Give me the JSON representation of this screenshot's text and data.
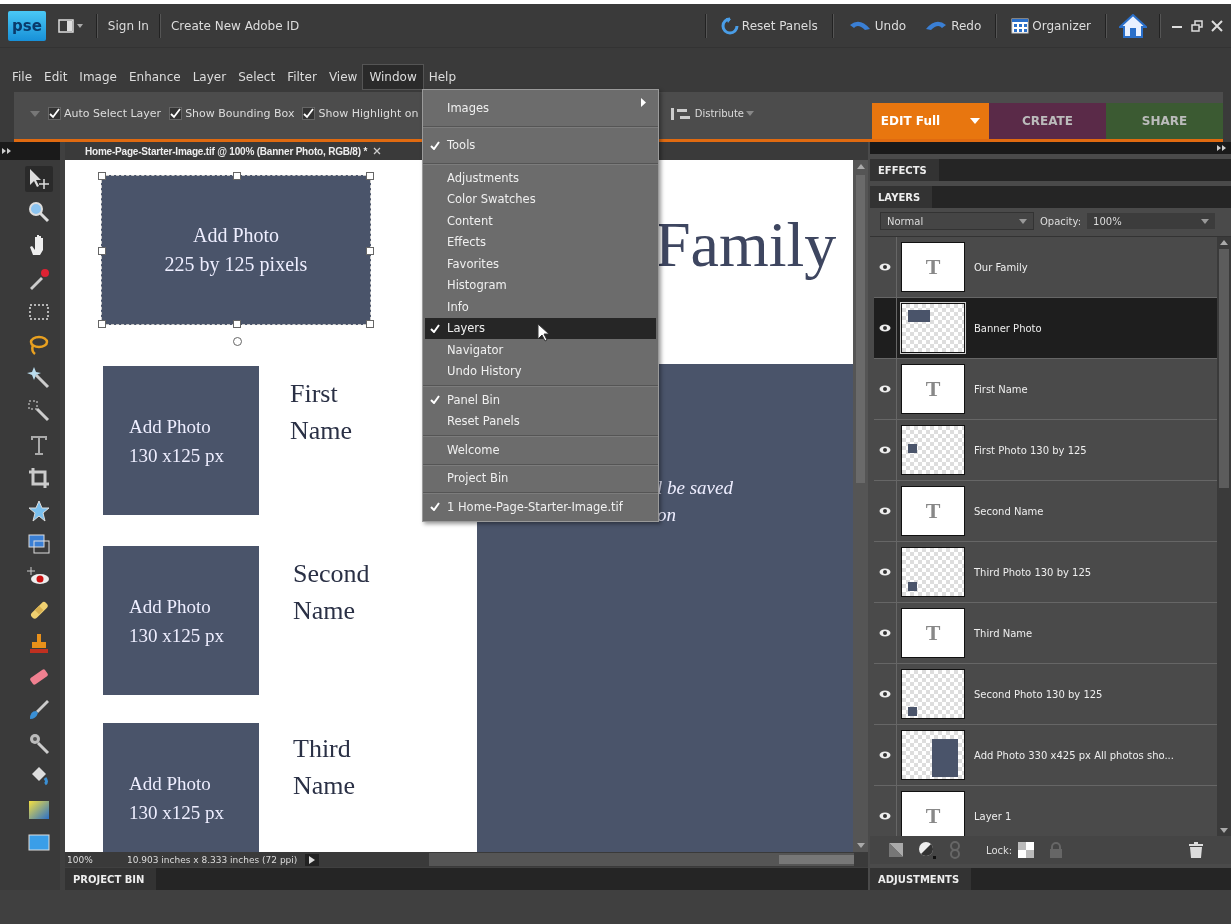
{
  "title_bar": {
    "logo": "pse",
    "sign_in": "Sign In",
    "create_id": "Create New Adobe ID",
    "actions": [
      {
        "kind": "reset",
        "label": "Reset Panels"
      },
      {
        "kind": "undo",
        "label": "Undo"
      },
      {
        "kind": "redo",
        "label": "Redo"
      },
      {
        "kind": "organizer",
        "label": "Organizer"
      }
    ]
  },
  "menu_bar": [
    {
      "label": "File",
      "selected": false
    },
    {
      "label": "Edit",
      "selected": false
    },
    {
      "label": "Image",
      "selected": false
    },
    {
      "label": "Enhance",
      "selected": false
    },
    {
      "label": "Layer",
      "selected": false
    },
    {
      "label": "Select",
      "selected": false
    },
    {
      "label": "Filter",
      "selected": false
    },
    {
      "label": "View",
      "selected": false
    },
    {
      "label": "Window",
      "selected": true
    },
    {
      "label": "Help",
      "selected": false
    }
  ],
  "options_bar": {
    "checkboxes": [
      {
        "label": "Auto Select Layer",
        "checked": true
      },
      {
        "label": "Show Bounding Box",
        "checked": true
      },
      {
        "label": "Show Highlight on",
        "checked": true
      }
    ],
    "distribute": "Distribute"
  },
  "mode_tabs": [
    {
      "label": "EDIT Full",
      "selected": true,
      "color": "#e8760f"
    },
    {
      "label": "CREATE",
      "selected": false,
      "color": "#5a2a48"
    },
    {
      "label": "SHARE",
      "selected": false,
      "color": "#3b5a32"
    }
  ],
  "document_tab": {
    "title": "Home-Page-Starter-Image.tif @ 100% (Banner Photo, RGB/8) *"
  },
  "tools": [
    {
      "kind": "move",
      "selected": true
    },
    {
      "kind": "zoom",
      "selected": false
    },
    {
      "kind": "hand",
      "selected": false
    },
    {
      "kind": "eyedropper",
      "selected": false
    },
    {
      "kind": "marquee",
      "selected": false
    },
    {
      "kind": "lasso",
      "selected": false
    },
    {
      "kind": "wand",
      "selected": false
    },
    {
      "kind": "brushsel",
      "selected": false
    },
    {
      "kind": "type",
      "selected": false
    },
    {
      "kind": "crop",
      "selected": false
    },
    {
      "kind": "shape",
      "selected": false
    },
    {
      "kind": "recompose",
      "selected": false
    },
    {
      "kind": "redeye",
      "selected": false
    },
    {
      "kind": "heal",
      "selected": false
    },
    {
      "kind": "stamp",
      "selected": false
    },
    {
      "kind": "eraser",
      "selected": false
    },
    {
      "kind": "brush",
      "selected": false
    },
    {
      "kind": "smartbrush",
      "selected": false
    },
    {
      "kind": "bucket",
      "selected": false
    },
    {
      "kind": "gradient",
      "selected": false
    },
    {
      "kind": "rect",
      "selected": false
    }
  ],
  "canvas": {
    "banner": {
      "line1": "Add Photo",
      "line2": "225 by 125 pixels"
    },
    "photos": [
      {
        "line1": "Add Photo",
        "line2": "130 x125 px",
        "name1": "First",
        "name2": "Name"
      },
      {
        "line1": "Add Photo",
        "line2": "130 x125 px",
        "name1": "Second",
        "name2": "Name"
      },
      {
        "line1": "Add Photo",
        "line2": "130 x125 px",
        "name1": "Third",
        "name2": "Name"
      }
    ],
    "heading": "Family",
    "note1": "l be saved",
    "note2": "on"
  },
  "status_bar": {
    "zoom": "100%",
    "info": "10.903 inches x 8.333 inches (72 ppi)"
  },
  "project_bin": "PROJECT BIN",
  "window_menu": [
    [
      {
        "label": "Images",
        "checked": false,
        "selected": false,
        "submenu": true
      }
    ],
    [
      {
        "label": "Tools",
        "checked": true,
        "selected": false,
        "submenu": false
      }
    ],
    [
      {
        "label": "Adjustments",
        "checked": false,
        "selected": false,
        "submenu": false
      },
      {
        "label": "Color Swatches",
        "checked": false,
        "selected": false,
        "submenu": false
      },
      {
        "label": "Content",
        "checked": false,
        "selected": false,
        "submenu": false
      },
      {
        "label": "Effects",
        "checked": false,
        "selected": false,
        "submenu": false
      },
      {
        "label": "Favorites",
        "checked": false,
        "selected": false,
        "submenu": false
      },
      {
        "label": "Histogram",
        "checked": false,
        "selected": false,
        "submenu": false
      },
      {
        "label": "Info",
        "checked": false,
        "selected": false,
        "submenu": false
      },
      {
        "label": "Layers",
        "checked": true,
        "selected": true,
        "submenu": false
      },
      {
        "label": "Navigator",
        "checked": false,
        "selected": false,
        "submenu": false
      },
      {
        "label": "Undo History",
        "checked": false,
        "selected": false,
        "submenu": false
      }
    ],
    [
      {
        "label": "Panel Bin",
        "checked": true,
        "selected": false,
        "submenu": false
      },
      {
        "label": "Reset Panels",
        "checked": false,
        "selected": false,
        "submenu": false
      }
    ],
    [
      {
        "label": "Welcome",
        "checked": false,
        "selected": false,
        "submenu": false
      }
    ],
    [
      {
        "label": "Project Bin",
        "checked": false,
        "selected": false,
        "submenu": false
      }
    ],
    [
      {
        "label": "1 Home-Page-Starter-Image.tif",
        "checked": true,
        "selected": false,
        "submenu": false
      }
    ]
  ],
  "effects_panel": "EFFECTS",
  "layers_panel": {
    "title": "LAYERS",
    "blend_mode": "Normal",
    "opacity_label": "Opacity:",
    "opacity": "100%",
    "lock_label": "Lock:",
    "layers": [
      {
        "name": "Our Family",
        "kind": "text",
        "glyph": "T",
        "selected": false,
        "visible": true
      },
      {
        "name": "Banner Photo",
        "kind": "image",
        "selected": true,
        "visible": true
      },
      {
        "name": "First Name",
        "kind": "text",
        "glyph": "T",
        "selected": false,
        "visible": true
      },
      {
        "name": "First Photo 130 by 125",
        "kind": "image",
        "selected": false,
        "visible": true
      },
      {
        "name": "Second Name",
        "kind": "text",
        "glyph": "T",
        "selected": false,
        "visible": true
      },
      {
        "name": "Third Photo 130 by 125",
        "kind": "image",
        "selected": false,
        "visible": true
      },
      {
        "name": "Third Name",
        "kind": "text",
        "glyph": "T",
        "selected": false,
        "visible": true
      },
      {
        "name": "Second Photo 130 by 125",
        "kind": "image",
        "selected": false,
        "visible": true
      },
      {
        "name": "Add Photo 330 x425 px All photos sho...",
        "kind": "image",
        "selected": false,
        "visible": true
      },
      {
        "name": "Layer 1",
        "kind": "text",
        "glyph": "T",
        "selected": false,
        "visible": true
      }
    ]
  },
  "adjustments_panel": "ADJUSTMENTS"
}
